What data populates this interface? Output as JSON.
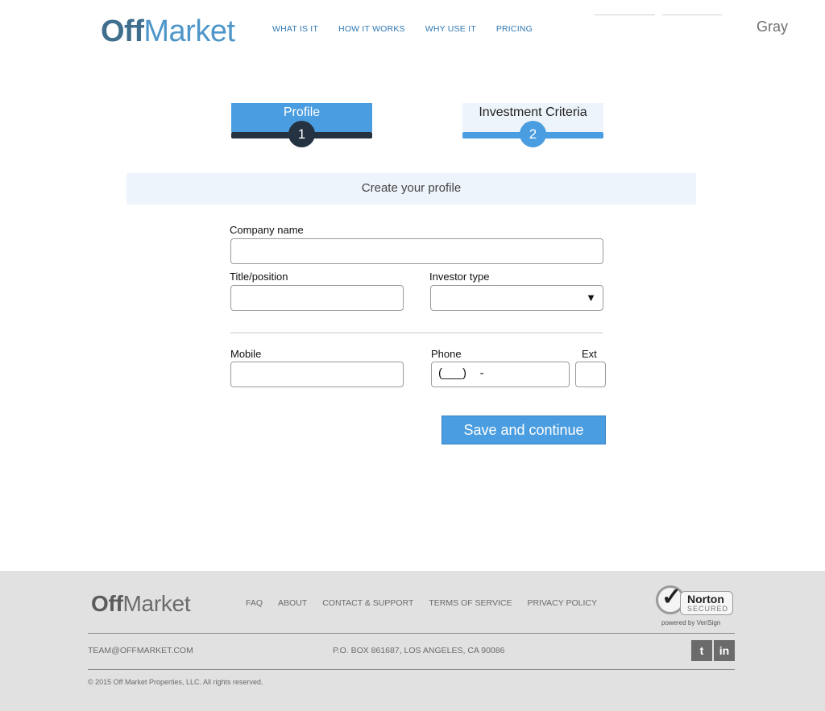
{
  "header": {
    "logo": {
      "bold": "Off",
      "light": "Market"
    },
    "nav": [
      "WHAT IS IT",
      "HOW IT WORKS",
      "WHY USE IT",
      "PRICING"
    ],
    "user_name": "Gray"
  },
  "steps": [
    {
      "label": "Profile",
      "number": "1",
      "state": "active"
    },
    {
      "label": "Investment Criteria",
      "number": "2",
      "state": "upcoming"
    }
  ],
  "form": {
    "section_title": "Create your profile",
    "fields": {
      "company_name": {
        "label": "Company name",
        "value": ""
      },
      "title_position": {
        "label": "Title/position",
        "value": ""
      },
      "investor_type": {
        "label": "Investor type",
        "selected": "",
        "arrow": "▼"
      },
      "mobile": {
        "label": "Mobile",
        "value": ""
      },
      "phone": {
        "label": "Phone",
        "mask": "(___)    -"
      },
      "ext": {
        "label": "Ext",
        "value": ""
      }
    },
    "submit_label": "Save and continue"
  },
  "footer": {
    "logo": {
      "bold": "Off",
      "light": "Market"
    },
    "links": [
      "FAQ",
      "ABOUT",
      "CONTACT & SUPPORT",
      "TERMS OF SERVICE",
      "PRIVACY POLICY"
    ],
    "norton": {
      "name": "Norton",
      "secured": "SECURED",
      "powered": "powered by VeriSign"
    },
    "email": "TEAM@OFFMARKET.COM",
    "address": "P.O. BOX 861687, LOS ANGELES, CA 90086",
    "social": {
      "twitter": "t",
      "linkedin": "in"
    },
    "copyright": "© 2015 Off Market Properties, LLC. All rights reserved."
  },
  "colors": {
    "accent": "#4a9de0",
    "dark_step": "#243242",
    "logo_dark": "#3f6f8c",
    "logo_light": "#4e96c9",
    "footer_bg": "#e1e1e1"
  }
}
